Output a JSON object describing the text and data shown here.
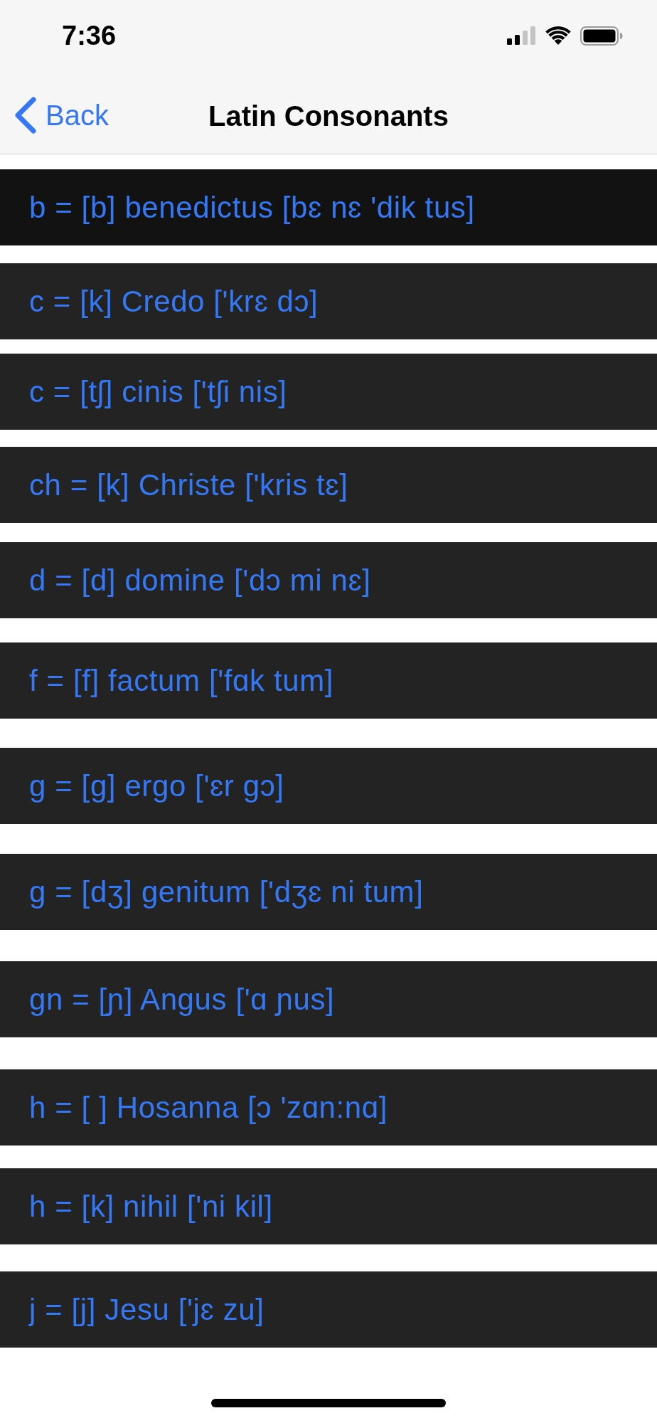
{
  "status_bar": {
    "time": "7:36"
  },
  "nav_bar": {
    "back_label": "Back",
    "title": "Latin Consonants"
  },
  "rows": [
    {
      "text": "b = [b] benedictus [bɛ nɛ 'dik tus]",
      "selected": true
    },
    {
      "text": "c = [k] Credo ['krɛ dɔ]",
      "selected": false
    },
    {
      "text": "c = [tʃ] cinis ['tʃi nis]",
      "selected": false
    },
    {
      "text": "ch = [k] Christe ['kris tɛ]",
      "selected": false
    },
    {
      "text": "d = [d] domine ['dɔ mi nɛ]",
      "selected": false
    },
    {
      "text": "f = [f] factum ['fɑk tum]",
      "selected": false
    },
    {
      "text": "g = [g] ergo ['ɛr gɔ]",
      "selected": false
    },
    {
      "text": "g = [dʒ] genitum ['dʒɛ ni tum]",
      "selected": false
    },
    {
      "text": "gn = [ɲ] Angus ['ɑ ɲus]",
      "selected": false
    },
    {
      "text": "h = [ ] Hosanna [ɔ 'zɑn:nɑ]",
      "selected": false
    },
    {
      "text": "h = [k] nihil ['ni kil]",
      "selected": false
    },
    {
      "text": "j = [j] Jesu ['jɛ zu]",
      "selected": false
    }
  ]
}
